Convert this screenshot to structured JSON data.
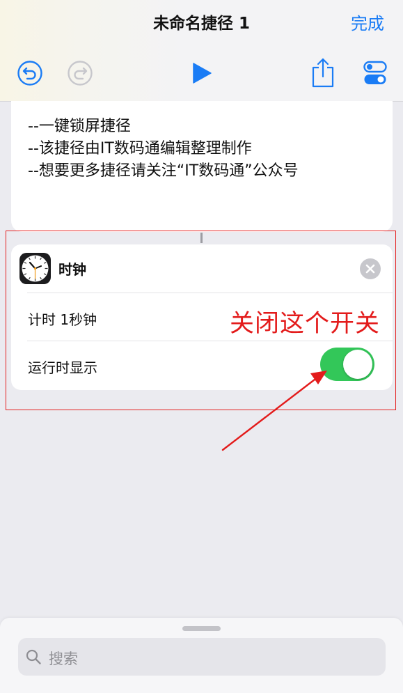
{
  "nav": {
    "title": "未命名捷径 1",
    "done_label": "完成"
  },
  "toolbar": {
    "undo_icon": "undo-icon",
    "redo_icon": "redo-icon",
    "play_icon": "play-icon",
    "share_icon": "share-icon",
    "settings_icon": "toggles-icon"
  },
  "comment": {
    "lines": [
      "--一键锁屏捷径",
      "--该捷径由IT数码通编辑整理制作",
      "--想要更多捷径请关注“IT数码通”公众号"
    ]
  },
  "action": {
    "app_name": "时钟",
    "app_icon": "clock-icon",
    "timer_row": "计时 1秒钟",
    "show_when_run_label": "运行时显示",
    "show_when_run": true
  },
  "annotation": {
    "text": "关闭这个开关",
    "color": "#e31b1b"
  },
  "search": {
    "placeholder": "搜索"
  },
  "colors": {
    "accent": "#1a7cf5",
    "toggle_on": "#33c759",
    "highlight": "#e42020"
  }
}
